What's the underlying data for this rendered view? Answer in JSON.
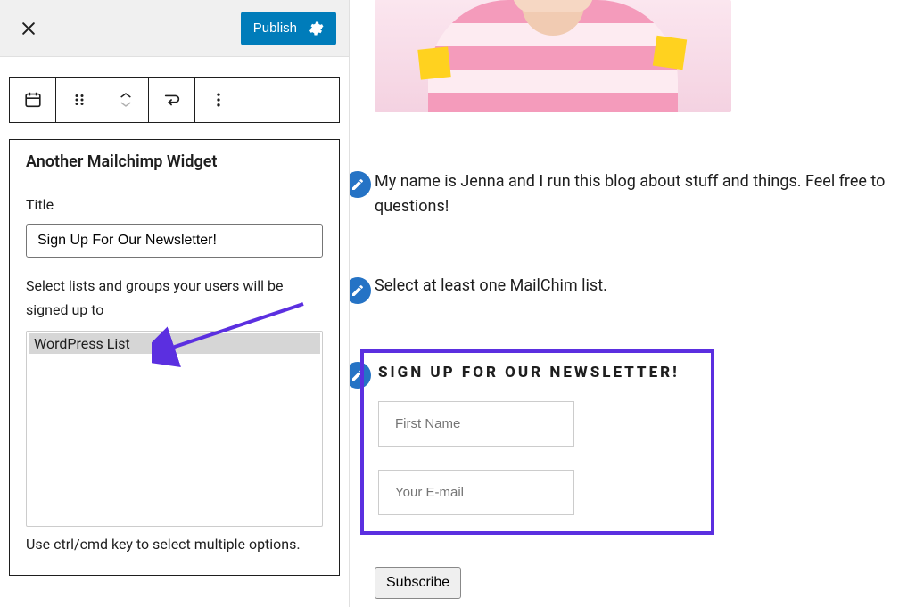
{
  "header": {
    "publish_label": "Publish"
  },
  "toolbar": {
    "block_icon": "calendar-icon",
    "drag_icon": "drag-icon",
    "move_up_icon": "chevron-up-icon",
    "move_down_icon": "chevron-down-icon",
    "transform_icon": "arrow-loop-icon",
    "more_icon": "more-vertical-icon"
  },
  "widget": {
    "panel_title": "Another Mailchimp Widget",
    "title_label": "Title",
    "title_value": "Sign Up For Our Newsletter!",
    "lists_label": "Select lists and groups your users will be signed up to",
    "lists_options": [
      "WordPress List"
    ],
    "lists_selected": "WordPress List",
    "multi_help": "Use ctrl/cmd key to select multiple options."
  },
  "preview": {
    "intro_text": "My name is Jenna and I run this blog about stuff and things. Feel free to questions!",
    "warn_text": "Select at least one MailChim list.",
    "signup_title": "SIGN UP FOR OUR NEWSLETTER!",
    "first_name_placeholder": "First Name",
    "email_placeholder": "Your E-mail",
    "subscribe_label": "Subscribe"
  },
  "colors": {
    "accent": "#007cba",
    "annotation": "#5b2fe0"
  }
}
